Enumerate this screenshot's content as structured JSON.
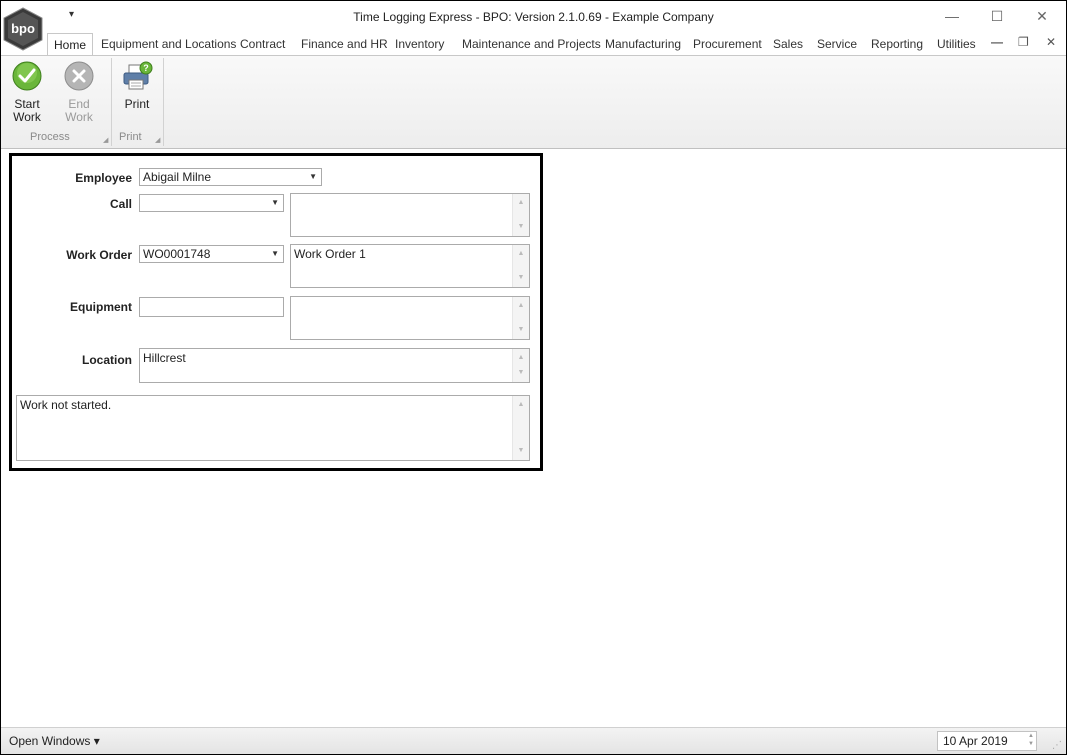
{
  "app": {
    "title": "Time Logging Express - BPO: Version 2.1.0.69 - Example Company",
    "logo_text": "bpo"
  },
  "titlebar": {
    "qat_arrow": "▾",
    "minimize": "—",
    "maximize": "☐",
    "close": "✕"
  },
  "tabs": [
    {
      "label": "Home"
    },
    {
      "label": "Equipment and Locations"
    },
    {
      "label": "Contract"
    },
    {
      "label": "Finance and HR"
    },
    {
      "label": "Inventory"
    },
    {
      "label": "Maintenance and Projects"
    },
    {
      "label": "Manufacturing"
    },
    {
      "label": "Procurement"
    },
    {
      "label": "Sales"
    },
    {
      "label": "Service"
    },
    {
      "label": "Reporting"
    },
    {
      "label": "Utilities"
    }
  ],
  "mdi": {
    "minimize": "—",
    "restore": "❐",
    "close": "✕"
  },
  "ribbon": {
    "start_work": "Start Work",
    "start_work_l1": "Start",
    "start_work_l2": "Work",
    "end_work": "End Work",
    "print": "Print",
    "group_process": "Process",
    "group_print": "Print",
    "start_icon": "check-circle-icon",
    "end_icon": "x-circle-icon",
    "print_icon": "printer-help-icon"
  },
  "form": {
    "employee_label": "Employee",
    "employee_value": "Abigail Milne",
    "call_label": "Call",
    "call_value": "",
    "call_desc": "",
    "work_order_label": "Work Order",
    "work_order_value": "WO0001748",
    "work_order_desc": "Work Order 1",
    "equipment_label": "Equipment",
    "equipment_value": "",
    "equipment_desc": "",
    "location_label": "Location",
    "location_value": "Hillcrest",
    "status_text": "Work not started."
  },
  "statusbar": {
    "open_windows": "Open Windows ▾",
    "date": "10 Apr 2019"
  },
  "colors": {
    "accent_green": "#5aa02c",
    "disabled_grey": "#9a9a9a",
    "panel_border": "#000000"
  }
}
